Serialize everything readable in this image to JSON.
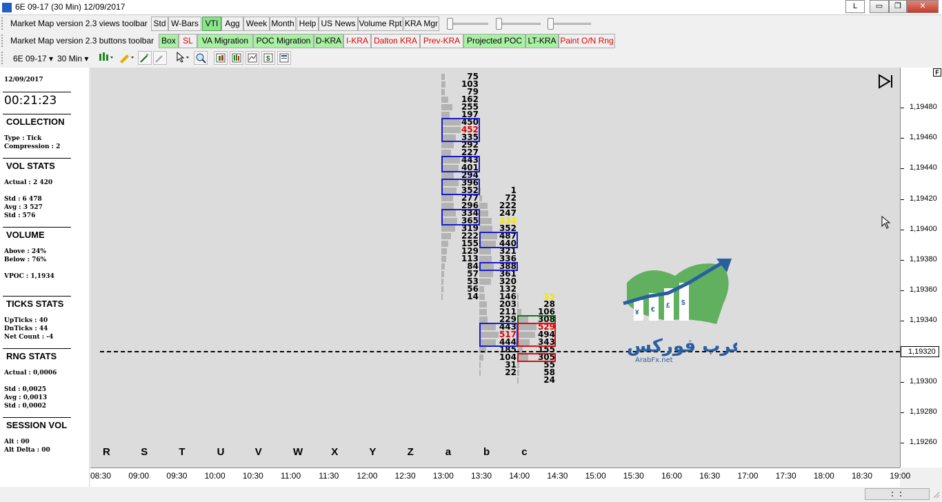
{
  "window": {
    "title": "6E 09-17 (30 Min)   12/09/2017",
    "l_button": "L",
    "min_glyph": "▭",
    "max_glyph": "❐",
    "close_glyph": "✕"
  },
  "views_toolbar": {
    "label": "Market Map version 2.3  views toolbar",
    "buttons": [
      "Std",
      "W-Bars",
      "VTI",
      "Agg",
      "Week",
      "Month",
      "Help",
      "US News",
      "Volume Rpt",
      "KRA Mgr"
    ],
    "active": "VTI"
  },
  "buttons_toolbar": {
    "label": "Market Map version 2.3  buttons toolbar",
    "buttons": [
      {
        "label": "Box",
        "style": "green"
      },
      {
        "label": "SL",
        "style": "red"
      },
      {
        "label": "VA Migration",
        "style": "green"
      },
      {
        "label": "POC Migration",
        "style": "green"
      },
      {
        "label": "D-KRA",
        "style": "green"
      },
      {
        "label": "I-KRA",
        "style": "red"
      },
      {
        "label": "Dalton KRA",
        "style": "red"
      },
      {
        "label": "Prev-KRA",
        "style": "red"
      },
      {
        "label": "Projected POC",
        "style": "green"
      },
      {
        "label": "LT-KRA",
        "style": "green"
      },
      {
        "label": "Paint O/N Rng",
        "style": "red"
      }
    ]
  },
  "chart_toolbar": {
    "instrument": "6E 09-17",
    "period": "30 Min",
    "dropdown_glyph": "▾"
  },
  "left_panel": {
    "date": "12/09/2017",
    "time": "00:21:23",
    "collection_head": "COLLECTION",
    "collection_type": "Type : Tick",
    "compression": "Compression : 2",
    "vol_stats_head": "VOL STATS",
    "actual_vol": "Actual : 2 420",
    "std_vol": "Std : 6 478",
    "avg_vol": "Avg : 3 527",
    "std2_vol": "Std : 576",
    "volume_head": "VOLUME",
    "above": "Above : 24%",
    "below": "Below : 76%",
    "vpoc": "VPOC : 1,1934",
    "ticks_head": "TICKS STATS",
    "upticks": "UpTicks : 40",
    "dnticks": "DnTicks : 44",
    "netcount": "Net Count : -4",
    "rng_head": "RNG STATS",
    "rng_actual": "Actual : 0,0006",
    "rng_std": "Std : 0,0025",
    "rng_avg": "Avg : 0,0013",
    "rng_std2": "Std : 0,0002",
    "session_head": "SESSION VOL",
    "alt": "Alt : 00",
    "alt_delta": "Alt Delta : 00"
  },
  "chart": {
    "f_button": "F",
    "current_price": "1,19320",
    "period_letters": [
      "R",
      "S",
      "T",
      "U",
      "V",
      "W",
      "X",
      "Y",
      "Z",
      "a",
      "b",
      "c"
    ],
    "x_ticks": [
      "08:30",
      "09:00",
      "09:30",
      "10:00",
      "10:30",
      "11:00",
      "11:30",
      "12:00",
      "12:30",
      "13:00",
      "13:30",
      "14:00",
      "14:30",
      "15:00",
      "15:30",
      "16:00",
      "16:30",
      "17:00",
      "17:30",
      "18:00",
      "18:30",
      "19:00"
    ],
    "y_ticks": [
      "1,19480",
      "1,19460",
      "1,19440",
      "1,19420",
      "1,19400",
      "1,19380",
      "1,19360",
      "1,19340",
      "1,19320",
      "1,19300",
      "1,19280",
      "1,19260"
    ],
    "watermark_text": "عرب فوركس",
    "watermark_url": "ArabFx.net",
    "col_a": [
      "75",
      "103",
      "79",
      "162",
      "255",
      "197",
      "450",
      "452",
      "335",
      "292",
      "227",
      "443",
      "401",
      "294",
      "396",
      "352",
      "277",
      "296",
      "334",
      "365",
      "319",
      "222",
      "155",
      "129",
      "113",
      "84",
      "57",
      "53",
      "56",
      "14"
    ],
    "col_b": [
      "1",
      "72",
      "222",
      "247",
      "334",
      "352",
      "487",
      "440",
      "321",
      "336",
      "388",
      "361",
      "320",
      "132",
      "146",
      "203",
      "211",
      "229",
      "443",
      "517",
      "444",
      "185",
      "104",
      "31",
      "22"
    ],
    "col_c": [
      "15",
      "28",
      "106",
      "308",
      "529",
      "494",
      "343",
      "155",
      "305",
      "55",
      "58",
      "24"
    ]
  },
  "chart_data": {
    "type": "table",
    "title": "",
    "note_columns": [
      "a",
      "b",
      "c"
    ],
    "a": [
      75,
      103,
      79,
      162,
      255,
      197,
      450,
      452,
      335,
      292,
      227,
      443,
      401,
      294,
      396,
      352,
      277,
      296,
      334,
      365,
      319,
      222,
      155,
      129,
      113,
      84,
      57,
      53,
      56,
      14
    ],
    "b": [
      1,
      72,
      222,
      247,
      334,
      352,
      487,
      440,
      321,
      336,
      388,
      361,
      320,
      132,
      146,
      203,
      211,
      229,
      443,
      517,
      444,
      185,
      104,
      31,
      22
    ],
    "c": [
      15,
      28,
      106,
      308,
      529,
      494,
      343,
      155,
      305,
      55,
      58,
      24
    ],
    "ylim": [
      1.1925,
      1.195
    ],
    "current_price": 1.1932
  },
  "colors": {
    "chart_bg": "#dcdcdc",
    "box_blue": "#1a1acc",
    "box_red": "#d41010",
    "box_green": "#107810",
    "highlight_red": "#e00000",
    "highlight_yellow": "#f5e600"
  }
}
